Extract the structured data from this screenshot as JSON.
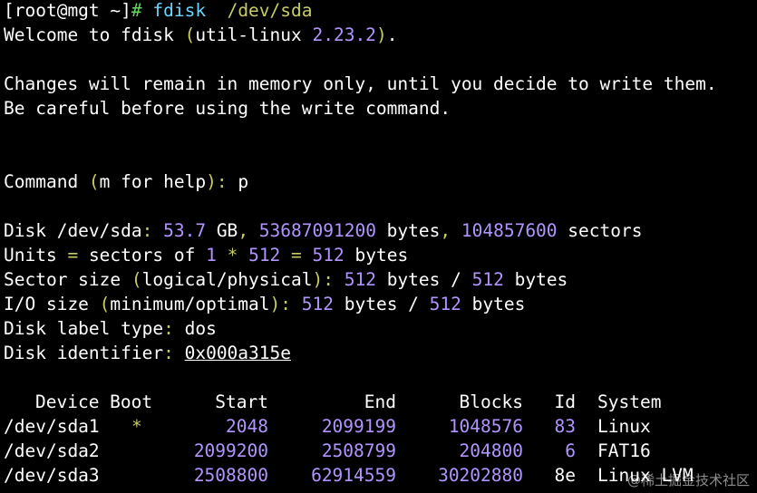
{
  "prompt": {
    "text": "[root@mgt ~]",
    "symbol": "#",
    "command": "fdisk",
    "arg": "/dev/sda"
  },
  "welcome": {
    "pre": "Welcome to fdisk ",
    "p1": "(",
    "name": "util-linux ",
    "version": "2.23.2",
    "p2": ")",
    "post": "."
  },
  "changes": [
    "Changes will remain in memory only, until you decide to write them.",
    "Be careful before using the write command."
  ],
  "command_prompt": {
    "label": "Command ",
    "p1": "(",
    "hint": "m for help",
    "p2": ")",
    "colon": ": ",
    "input": "p"
  },
  "disk": {
    "label": "Disk /dev/sda",
    "colon": ": ",
    "size": "53.7",
    "unit": " GB",
    "comma1": ", ",
    "bytes": "53687091200",
    "bytes_label": " bytes",
    "comma2": ", ",
    "sectors": "104857600",
    "sectors_label": " sectors"
  },
  "units": {
    "label": "Units ",
    "eq1": "=",
    "mid": " sectors of ",
    "one": "1",
    "star": " * ",
    "a": "512",
    "eq2": " = ",
    "b": "512",
    "end": " bytes"
  },
  "sector_size": {
    "label": "Sector size ",
    "p1": "(",
    "inner": "logical/physical",
    "p2": ")",
    "colon": ": ",
    "a": "512",
    "mid": " bytes / ",
    "b": "512",
    "end": " bytes"
  },
  "io_size": {
    "label": "I/O size ",
    "p1": "(",
    "inner": "minimum/optimal",
    "p2": ")",
    "colon": ": ",
    "a": "512",
    "mid": " bytes / ",
    "b": "512",
    "end": " bytes"
  },
  "label_type": {
    "label": "Disk label type",
    "colon": ": ",
    "value": "dos"
  },
  "identifier": {
    "label": "Disk identifier",
    "colon": ": ",
    "value": "0x000a315e"
  },
  "table": {
    "headers": [
      "Device Boot",
      "Start",
      "End",
      "Blocks",
      "Id",
      "System"
    ],
    "rows": [
      {
        "device": "/dev/sda1",
        "boot": "*",
        "start": "2048",
        "end": "2099199",
        "blocks": "1048576",
        "id": "83",
        "system": "Linux"
      },
      {
        "device": "/dev/sda2",
        "boot": "",
        "start": "2099200",
        "end": "2508799",
        "blocks": "204800",
        "id": "6",
        "system": "FAT16"
      },
      {
        "device": "/dev/sda3",
        "boot": "",
        "start": "2508800",
        "end": "62914559",
        "blocks": "30202880",
        "id": "8e",
        "system": "Linux LVM"
      }
    ]
  },
  "watermark": "@稀土掘金技术社区"
}
